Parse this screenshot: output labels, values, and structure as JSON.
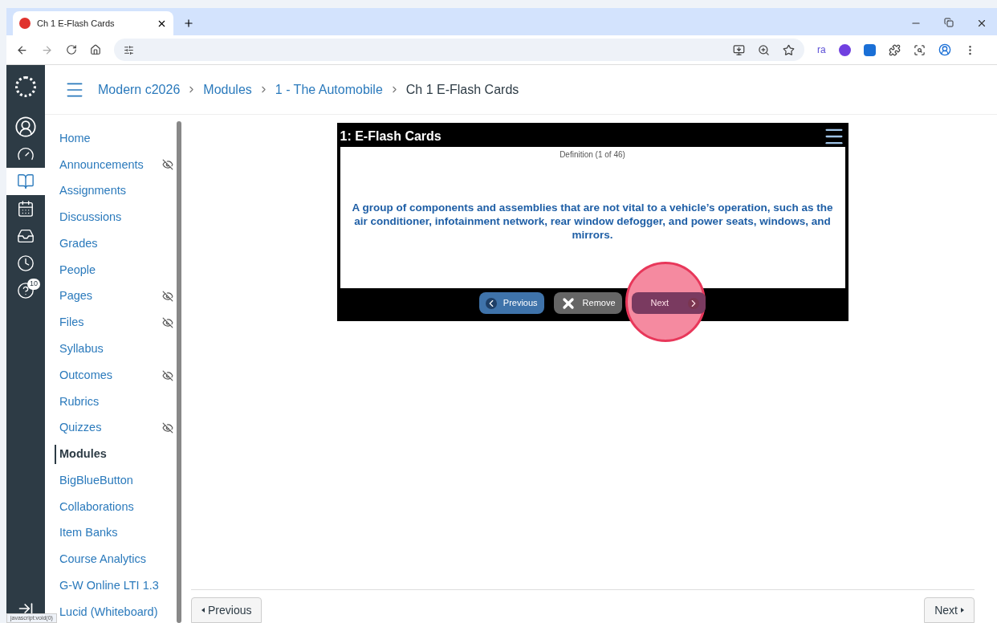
{
  "browser": {
    "tab_title": "Ch 1 E-Flash Cards",
    "extension_label": "ra"
  },
  "breadcrumbs": [
    {
      "label": "Modern c2026",
      "current": false
    },
    {
      "label": "Modules",
      "current": false
    },
    {
      "label": "1 - The Automobile",
      "current": false
    },
    {
      "label": "Ch 1 E-Flash Cards",
      "current": true
    }
  ],
  "global_nav": {
    "items": [
      {
        "kind": "account",
        "selected": false
      },
      {
        "kind": "dashboard",
        "selected": false
      },
      {
        "kind": "courses",
        "selected": true
      },
      {
        "kind": "calendar",
        "selected": false
      },
      {
        "kind": "inbox",
        "selected": false
      },
      {
        "kind": "history",
        "selected": false
      },
      {
        "kind": "help",
        "selected": false,
        "badge": "10"
      }
    ]
  },
  "course_nav": [
    {
      "label": "Home",
      "selected": false,
      "hidden": false
    },
    {
      "label": "Announcements",
      "selected": false,
      "hidden": true
    },
    {
      "label": "Assignments",
      "selected": false,
      "hidden": false
    },
    {
      "label": "Discussions",
      "selected": false,
      "hidden": false
    },
    {
      "label": "Grades",
      "selected": false,
      "hidden": false
    },
    {
      "label": "People",
      "selected": false,
      "hidden": false
    },
    {
      "label": "Pages",
      "selected": false,
      "hidden": true
    },
    {
      "label": "Files",
      "selected": false,
      "hidden": true
    },
    {
      "label": "Syllabus",
      "selected": false,
      "hidden": false
    },
    {
      "label": "Outcomes",
      "selected": false,
      "hidden": true
    },
    {
      "label": "Rubrics",
      "selected": false,
      "hidden": false
    },
    {
      "label": "Quizzes",
      "selected": false,
      "hidden": true
    },
    {
      "label": "Modules",
      "selected": true,
      "hidden": false
    },
    {
      "label": "BigBlueButton",
      "selected": false,
      "hidden": false
    },
    {
      "label": "Collaborations",
      "selected": false,
      "hidden": false
    },
    {
      "label": "Item Banks",
      "selected": false,
      "hidden": false
    },
    {
      "label": "Course Analytics",
      "selected": false,
      "hidden": false
    },
    {
      "label": "G-W Online LTI 1.3",
      "selected": false,
      "hidden": false
    },
    {
      "label": "Lucid (Whiteboard)",
      "selected": false,
      "hidden": false
    }
  ],
  "flashcards": {
    "title": "1: E-Flash Cards",
    "counter": "Definition (1 of 46)",
    "definition": "A group of components and assemblies that are not vital to a vehicle’s operation, such as the air conditioner, infotainment network, rear window defogger, and power seats, windows, and mirrors.",
    "buttons": [
      {
        "kind": "previous",
        "label": "Previous",
        "highlighted": false
      },
      {
        "kind": "remove",
        "label": "Remove",
        "highlighted": false
      },
      {
        "kind": "next",
        "label": "Next",
        "highlighted": true
      }
    ]
  },
  "footer": {
    "previous": "Previous",
    "next": "Next"
  },
  "status_bar": "javascript:void(0)"
}
